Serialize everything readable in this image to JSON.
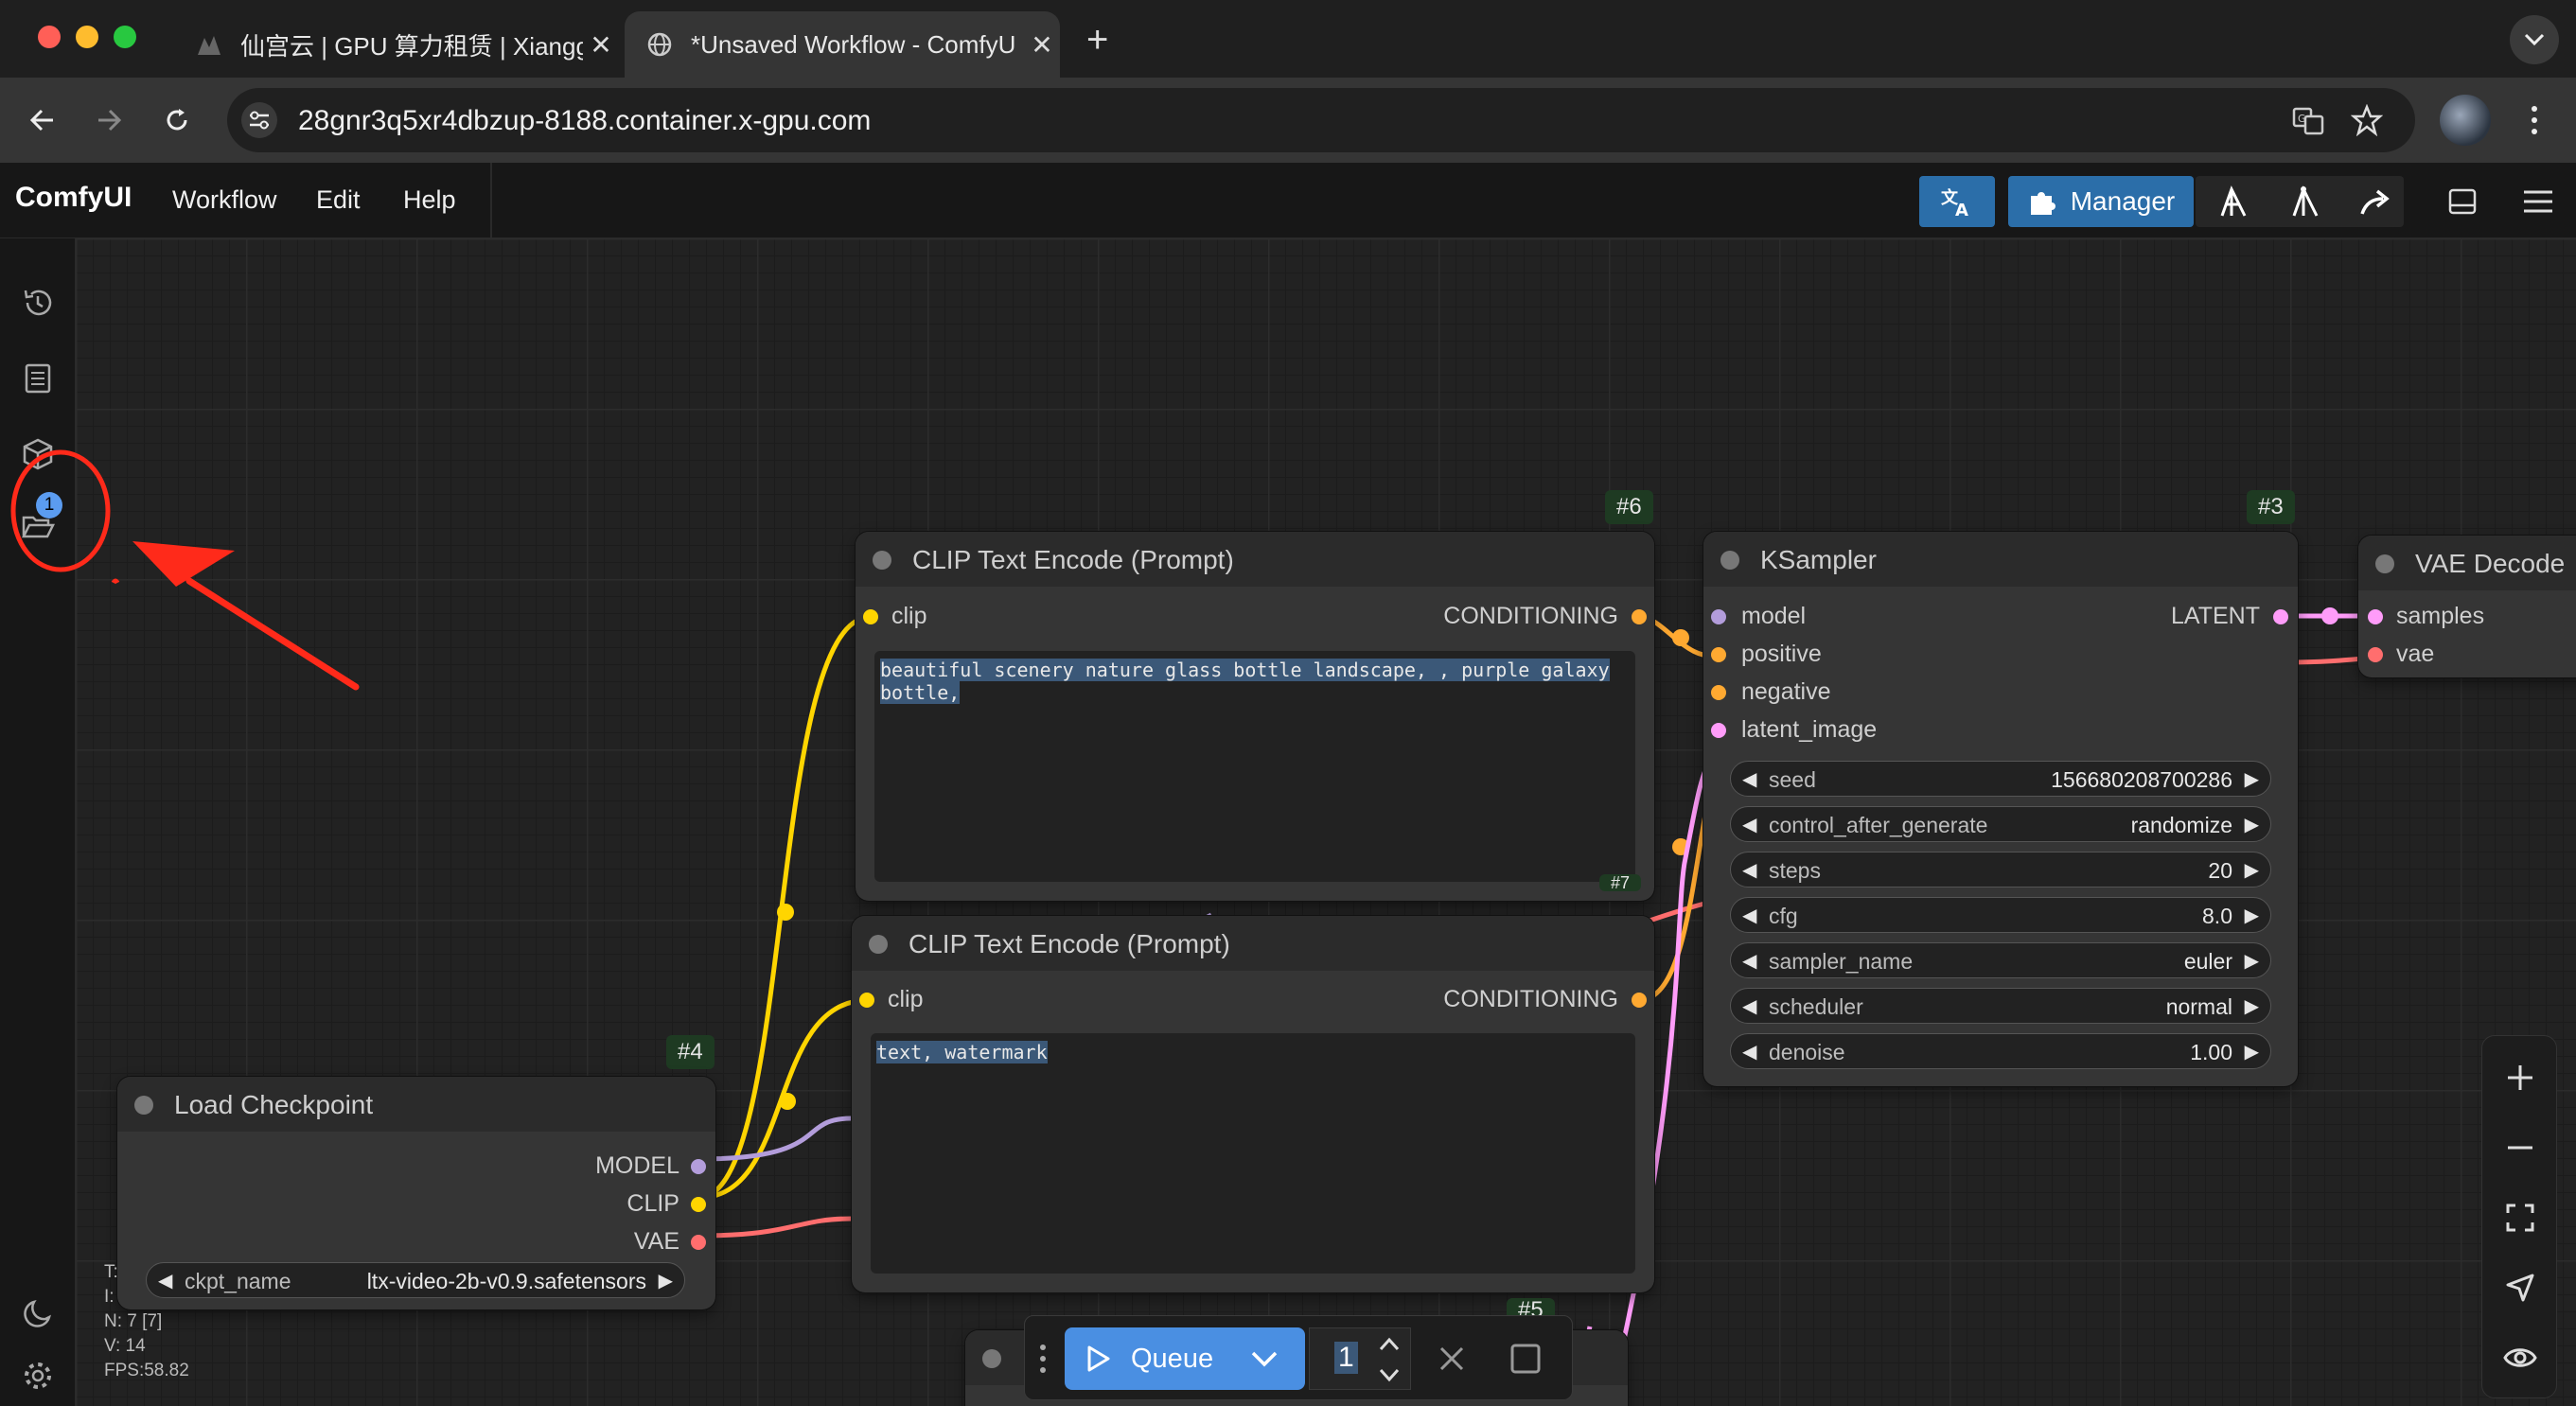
{
  "browser": {
    "tabs": [
      {
        "title": "仙宫云 | GPU 算力租赁 | Xiangg",
        "active": false
      },
      {
        "title": "*Unsaved Workflow - ComfyU",
        "active": true
      }
    ],
    "url": "28gnr3q5xr4dbzup-8188.container.x-gpu.com"
  },
  "app": {
    "logo": "ComfyUI",
    "menu": [
      "Workflow",
      "Edit",
      "Help"
    ],
    "toolbar": {
      "manager_label": "Manager"
    },
    "sidebar": {
      "queue_badge": "1"
    }
  },
  "nodes": {
    "clip_pos": {
      "badge": "#6",
      "title": "CLIP Text Encode (Prompt)",
      "input": "clip",
      "output": "CONDITIONING",
      "text": "beautiful scenery nature glass bottle landscape, , purple galaxy bottle,"
    },
    "clip_neg": {
      "badge": "#7",
      "title": "CLIP Text Encode (Prompt)",
      "input": "clip",
      "output": "CONDITIONING",
      "text": "text, watermark"
    },
    "ksampler": {
      "badge": "#3",
      "title": "KSampler",
      "inputs": [
        "model",
        "positive",
        "negative",
        "latent_image"
      ],
      "output": "LATENT",
      "widgets": [
        {
          "label": "seed",
          "value": "156680208700286"
        },
        {
          "label": "control_after_generate",
          "value": "randomize"
        },
        {
          "label": "steps",
          "value": "20"
        },
        {
          "label": "cfg",
          "value": "8.0"
        },
        {
          "label": "sampler_name",
          "value": "euler"
        },
        {
          "label": "scheduler",
          "value": "normal"
        },
        {
          "label": "denoise",
          "value": "1.00"
        }
      ]
    },
    "checkpoint": {
      "badge": "#4",
      "title": "Load Checkpoint",
      "outputs": [
        "MODEL",
        "CLIP",
        "VAE"
      ],
      "widget": {
        "label": "ckpt_name",
        "value": "ltx-video-2b-v0.9.safetensors"
      }
    },
    "vae_decode": {
      "title": "VAE Decode",
      "inputs": [
        "samples",
        "vae"
      ]
    },
    "empty_latent": {
      "badge": "#5"
    }
  },
  "stats": [
    "T:",
    "I:",
    "N: 7 [7]",
    "V: 14",
    "FPS:58.82"
  ],
  "queue": {
    "label": "Queue",
    "count": "1"
  },
  "colors": {
    "accent_blue": "#4a8fe2",
    "clip_wire": "#ffd500",
    "model_wire": "#b39ddb",
    "vae_wire": "#ff6e6e",
    "latent_wire": "#ff9cf9",
    "conditioning_wire": "#ffa931",
    "annotation_red": "#ff2a1a"
  }
}
